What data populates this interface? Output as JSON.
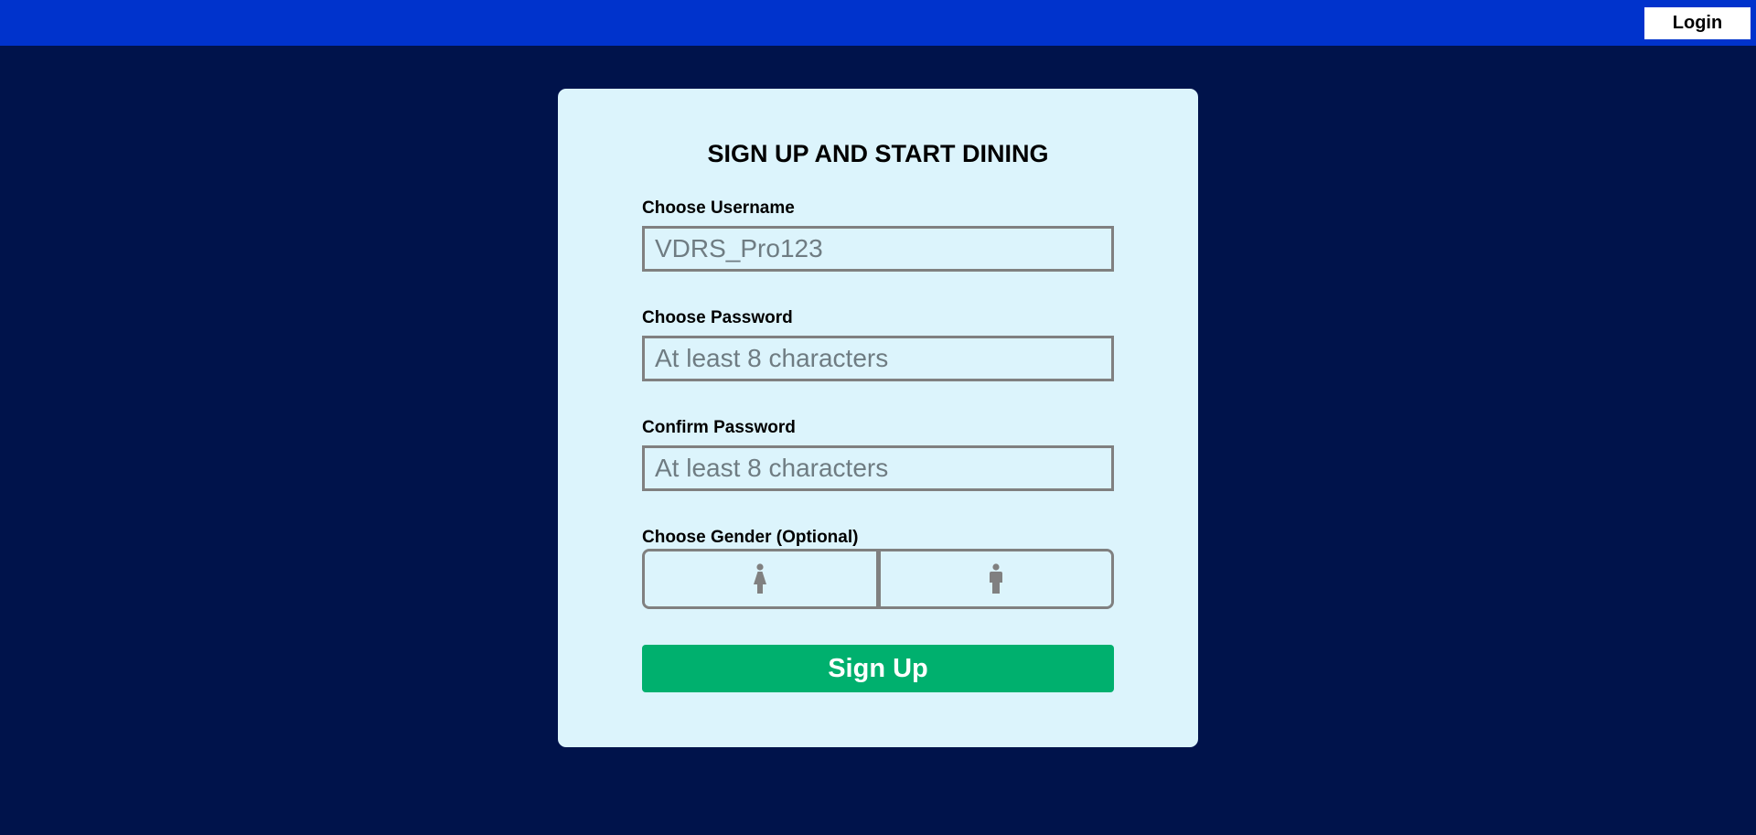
{
  "header": {
    "login_label": "Login"
  },
  "form": {
    "title": "SIGN UP AND START DINING",
    "username": {
      "label": "Choose Username",
      "placeholder": "VDRS_Pro123",
      "value": ""
    },
    "password": {
      "label": "Choose Password",
      "placeholder": "At least 8 characters",
      "value": ""
    },
    "confirm_password": {
      "label": "Confirm Password",
      "placeholder": "At least 8 characters",
      "value": ""
    },
    "gender": {
      "label": "Choose Gender (Optional)",
      "options": [
        {
          "icon": "female-icon"
        },
        {
          "icon": "male-icon"
        }
      ]
    },
    "submit_label": "Sign Up"
  },
  "colors": {
    "page_background": "#00134b",
    "header_background": "#0033cc",
    "card_background": "#dcf4fc",
    "field_border": "#808080",
    "submit_background": "#00b06e",
    "submit_text": "#ffffff"
  }
}
